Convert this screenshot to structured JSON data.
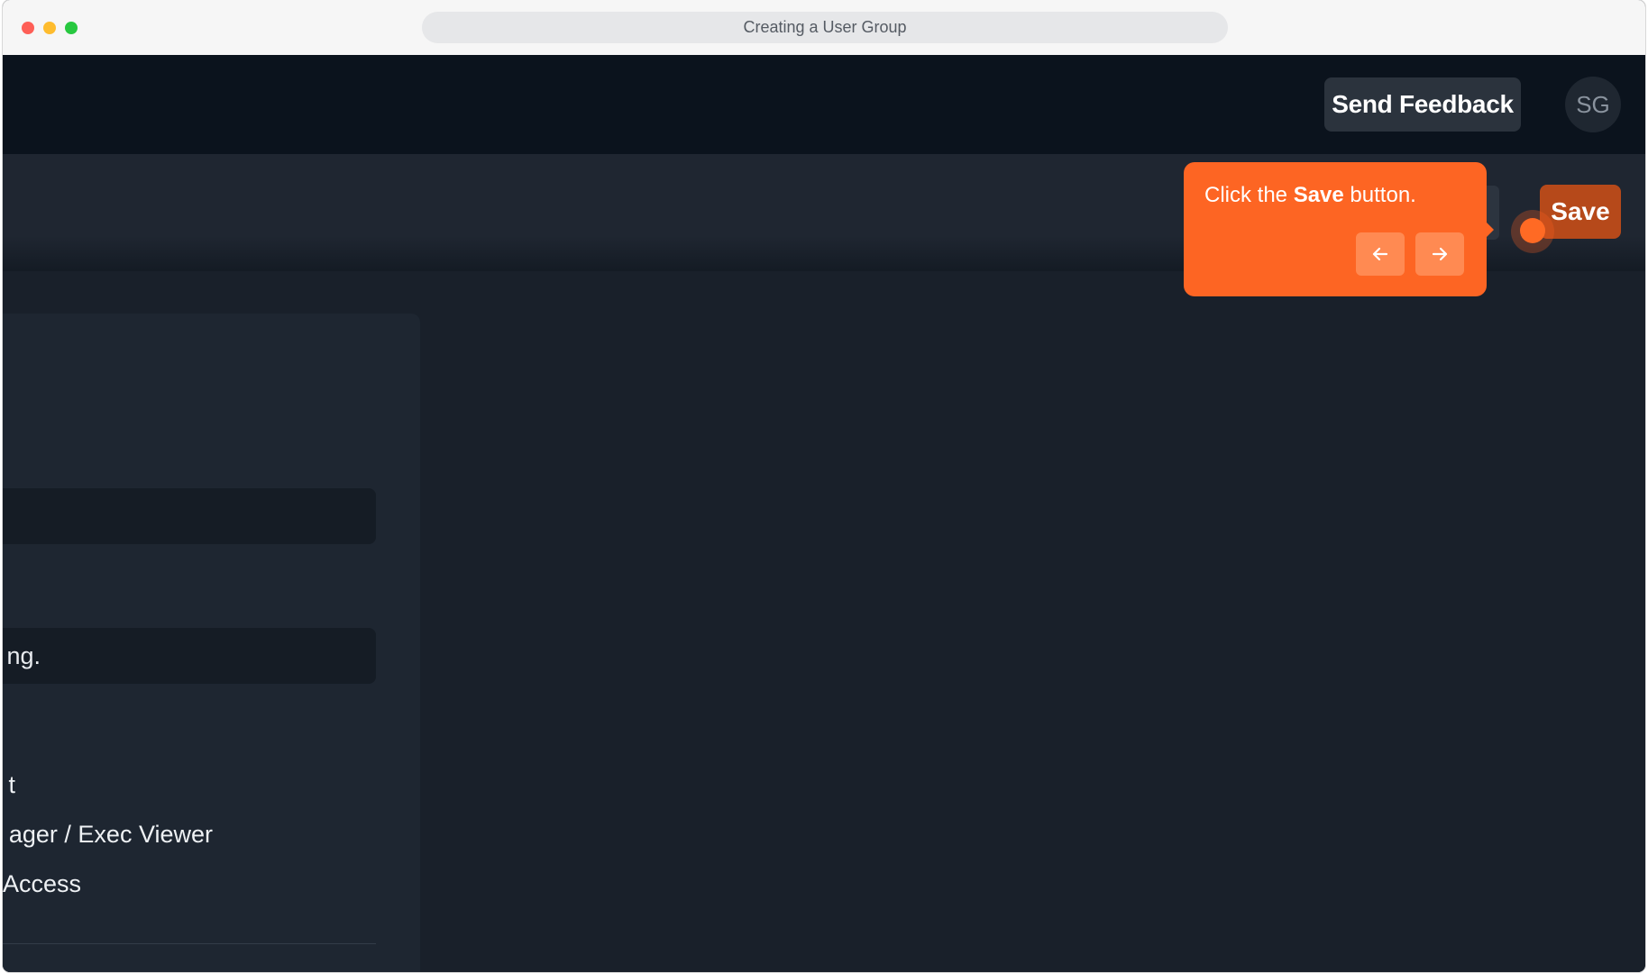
{
  "browser": {
    "title": "Creating a User Group"
  },
  "topnav": {
    "feedback_label": "Send Feedback",
    "avatar_initials": "SG"
  },
  "header": {
    "save_label": "Save"
  },
  "tooltip": {
    "text_before": "Click the ",
    "text_bold": "Save",
    "text_after": " button."
  },
  "form": {
    "name_value": "",
    "description_value_visible": "ng.",
    "options": [
      {
        "label_visible": "t"
      },
      {
        "label_visible": "ager / Exec Viewer"
      },
      {
        "label_visible": "Access"
      }
    ]
  },
  "colors": {
    "accent": "#fd6523",
    "save_button": "#b6491a",
    "nav_bg": "#0b131d",
    "content_bg": "#19202a"
  }
}
